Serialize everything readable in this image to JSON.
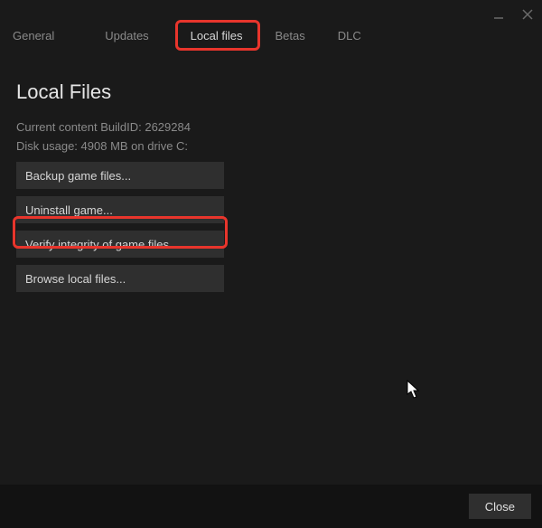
{
  "window": {
    "minimize": "—",
    "close": "×"
  },
  "tabs": {
    "general": "General",
    "updates": "Updates",
    "local_files": "Local files",
    "betas": "Betas",
    "dlc": "DLC"
  },
  "page": {
    "title": "Local Files",
    "build_line": "Current content BuildID: 2629284",
    "disk_line": "Disk usage: 4908 MB on drive C:"
  },
  "actions": {
    "backup": "Backup game files...",
    "uninstall": "Uninstall game...",
    "verify": "Verify integrity of game files...",
    "browse": "Browse local files..."
  },
  "footer": {
    "close": "Close"
  }
}
